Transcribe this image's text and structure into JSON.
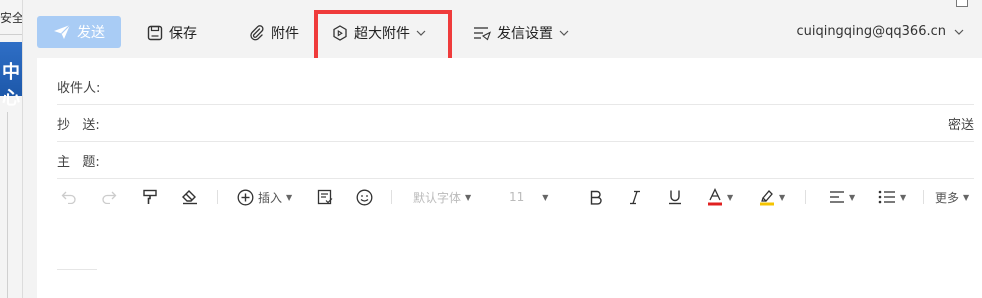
{
  "side": {
    "tab_text": "安全",
    "panel_text": "中心"
  },
  "toolbar": {
    "send_label": "发送",
    "save_label": "保存",
    "attach_label": "附件",
    "big_attach_label": "超大附件",
    "send_settings_label": "发信设置"
  },
  "account": {
    "email": "cuiqingqing@qq366.cn"
  },
  "compose": {
    "to_label": "收件人:",
    "cc_label": "抄   送:",
    "bcc_link": "密送",
    "subject_label": "主   题:"
  },
  "format": {
    "insert_label": "插入",
    "font_label": "默认字体",
    "size_label": "11",
    "more_label": "更多"
  },
  "colors": {
    "accent": "#a9ccf5",
    "highlight": "#ef3b3b",
    "font_color_bar": "#e02020",
    "highlight_bar": "#f5c400"
  }
}
